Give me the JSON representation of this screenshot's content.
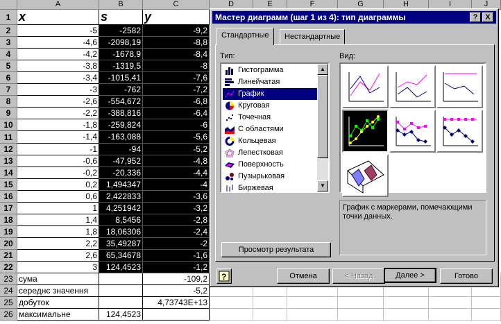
{
  "sheet": {
    "columns": [
      "A",
      "B",
      "C",
      "D",
      "E",
      "F",
      "G",
      "H",
      "I",
      "J"
    ],
    "header_row": {
      "row": "1",
      "a": "x",
      "b": "s",
      "c": "y"
    },
    "rows": [
      {
        "n": "2",
        "a": "-5",
        "b": "-2582",
        "c": "-9,2"
      },
      {
        "n": "3",
        "a": "-4,6",
        "b": "-2098,19",
        "c": "-8,8"
      },
      {
        "n": "4",
        "a": "-4,2",
        "b": "-1678,9",
        "c": "-8,4"
      },
      {
        "n": "5",
        "a": "-3,8",
        "b": "-1319,5",
        "c": "-8"
      },
      {
        "n": "6",
        "a": "-3,4",
        "b": "-1015,41",
        "c": "-7,6"
      },
      {
        "n": "7",
        "a": "-3",
        "b": "-762",
        "c": "-7,2"
      },
      {
        "n": "8",
        "a": "-2,6",
        "b": "-554,672",
        "c": "-6,8"
      },
      {
        "n": "9",
        "a": "-2,2",
        "b": "-388,816",
        "c": "-6,4"
      },
      {
        "n": "10",
        "a": "-1,8",
        "b": "-259,824",
        "c": "-6"
      },
      {
        "n": "11",
        "a": "-1,4",
        "b": "-163,088",
        "c": "-5,6"
      },
      {
        "n": "12",
        "a": "-1",
        "b": "-94",
        "c": "-5,2"
      },
      {
        "n": "13",
        "a": "-0,6",
        "b": "-47,952",
        "c": "-4,8"
      },
      {
        "n": "14",
        "a": "-0,2",
        "b": "-20,336",
        "c": "-4,4"
      },
      {
        "n": "15",
        "a": "0,2",
        "b": "1,494347",
        "c": "-4"
      },
      {
        "n": "16",
        "a": "0,6",
        "b": "2,422833",
        "c": "-3,6"
      },
      {
        "n": "17",
        "a": "1",
        "b": "4,251942",
        "c": "-3,2"
      },
      {
        "n": "18",
        "a": "1,4",
        "b": "8,5456",
        "c": "-2,8"
      },
      {
        "n": "19",
        "a": "1,8",
        "b": "18,06306",
        "c": "-2,4"
      },
      {
        "n": "20",
        "a": "2,2",
        "b": "35,49287",
        "c": "-2"
      },
      {
        "n": "21",
        "a": "2,6",
        "b": "65,34678",
        "c": "-1,6"
      },
      {
        "n": "22",
        "a": "3",
        "b": "124,4523",
        "c": "-1,2"
      }
    ],
    "summary": [
      {
        "n": "23",
        "a": "сума",
        "b": "",
        "c": "-109,2"
      },
      {
        "n": "24",
        "a": "середнє значення",
        "b": "",
        "c": "-5,2"
      },
      {
        "n": "25",
        "a": "добуток",
        "b": "",
        "c": "4,73743E+13"
      },
      {
        "n": "26",
        "a": "максимальне",
        "b": "124,4523",
        "c": ""
      }
    ]
  },
  "dialog": {
    "title": "Мастер диаграмм (шаг 1 из 4): тип диаграммы",
    "help_btn": "?",
    "close_btn": "X",
    "tabs": [
      "Стандартные",
      "Нестандартные"
    ],
    "type_label": "Тип:",
    "view_label": "Вид:",
    "chart_types": [
      {
        "label": "Гистограмма",
        "icon": "column-chart-icon"
      },
      {
        "label": "Линейчатая",
        "icon": "bar-chart-icon"
      },
      {
        "label": "График",
        "icon": "line-chart-icon",
        "selected": true
      },
      {
        "label": "Круговая",
        "icon": "pie-chart-icon"
      },
      {
        "label": "Точечная",
        "icon": "scatter-chart-icon"
      },
      {
        "label": "С областями",
        "icon": "area-chart-icon"
      },
      {
        "label": "Кольцевая",
        "icon": "doughnut-chart-icon"
      },
      {
        "label": "Лепестковая",
        "icon": "radar-chart-icon"
      },
      {
        "label": "Поверхность",
        "icon": "surface-chart-icon"
      },
      {
        "label": "Пузырьковая",
        "icon": "bubble-chart-icon"
      },
      {
        "label": "Биржевая",
        "icon": "stock-chart-icon"
      }
    ],
    "description": "График с маркерами, помечающими точки данных.",
    "preview_btn": "Просмотр результата",
    "cancel_btn": "Отмена",
    "back_btn": "< Назад",
    "next_btn": "Далее >",
    "finish_btn": "Готово",
    "colors": {
      "title_bg": "#000080",
      "accent_magenta": "#ff00ff",
      "accent_navy": "#000080",
      "marker_green": "#00ff00"
    }
  }
}
